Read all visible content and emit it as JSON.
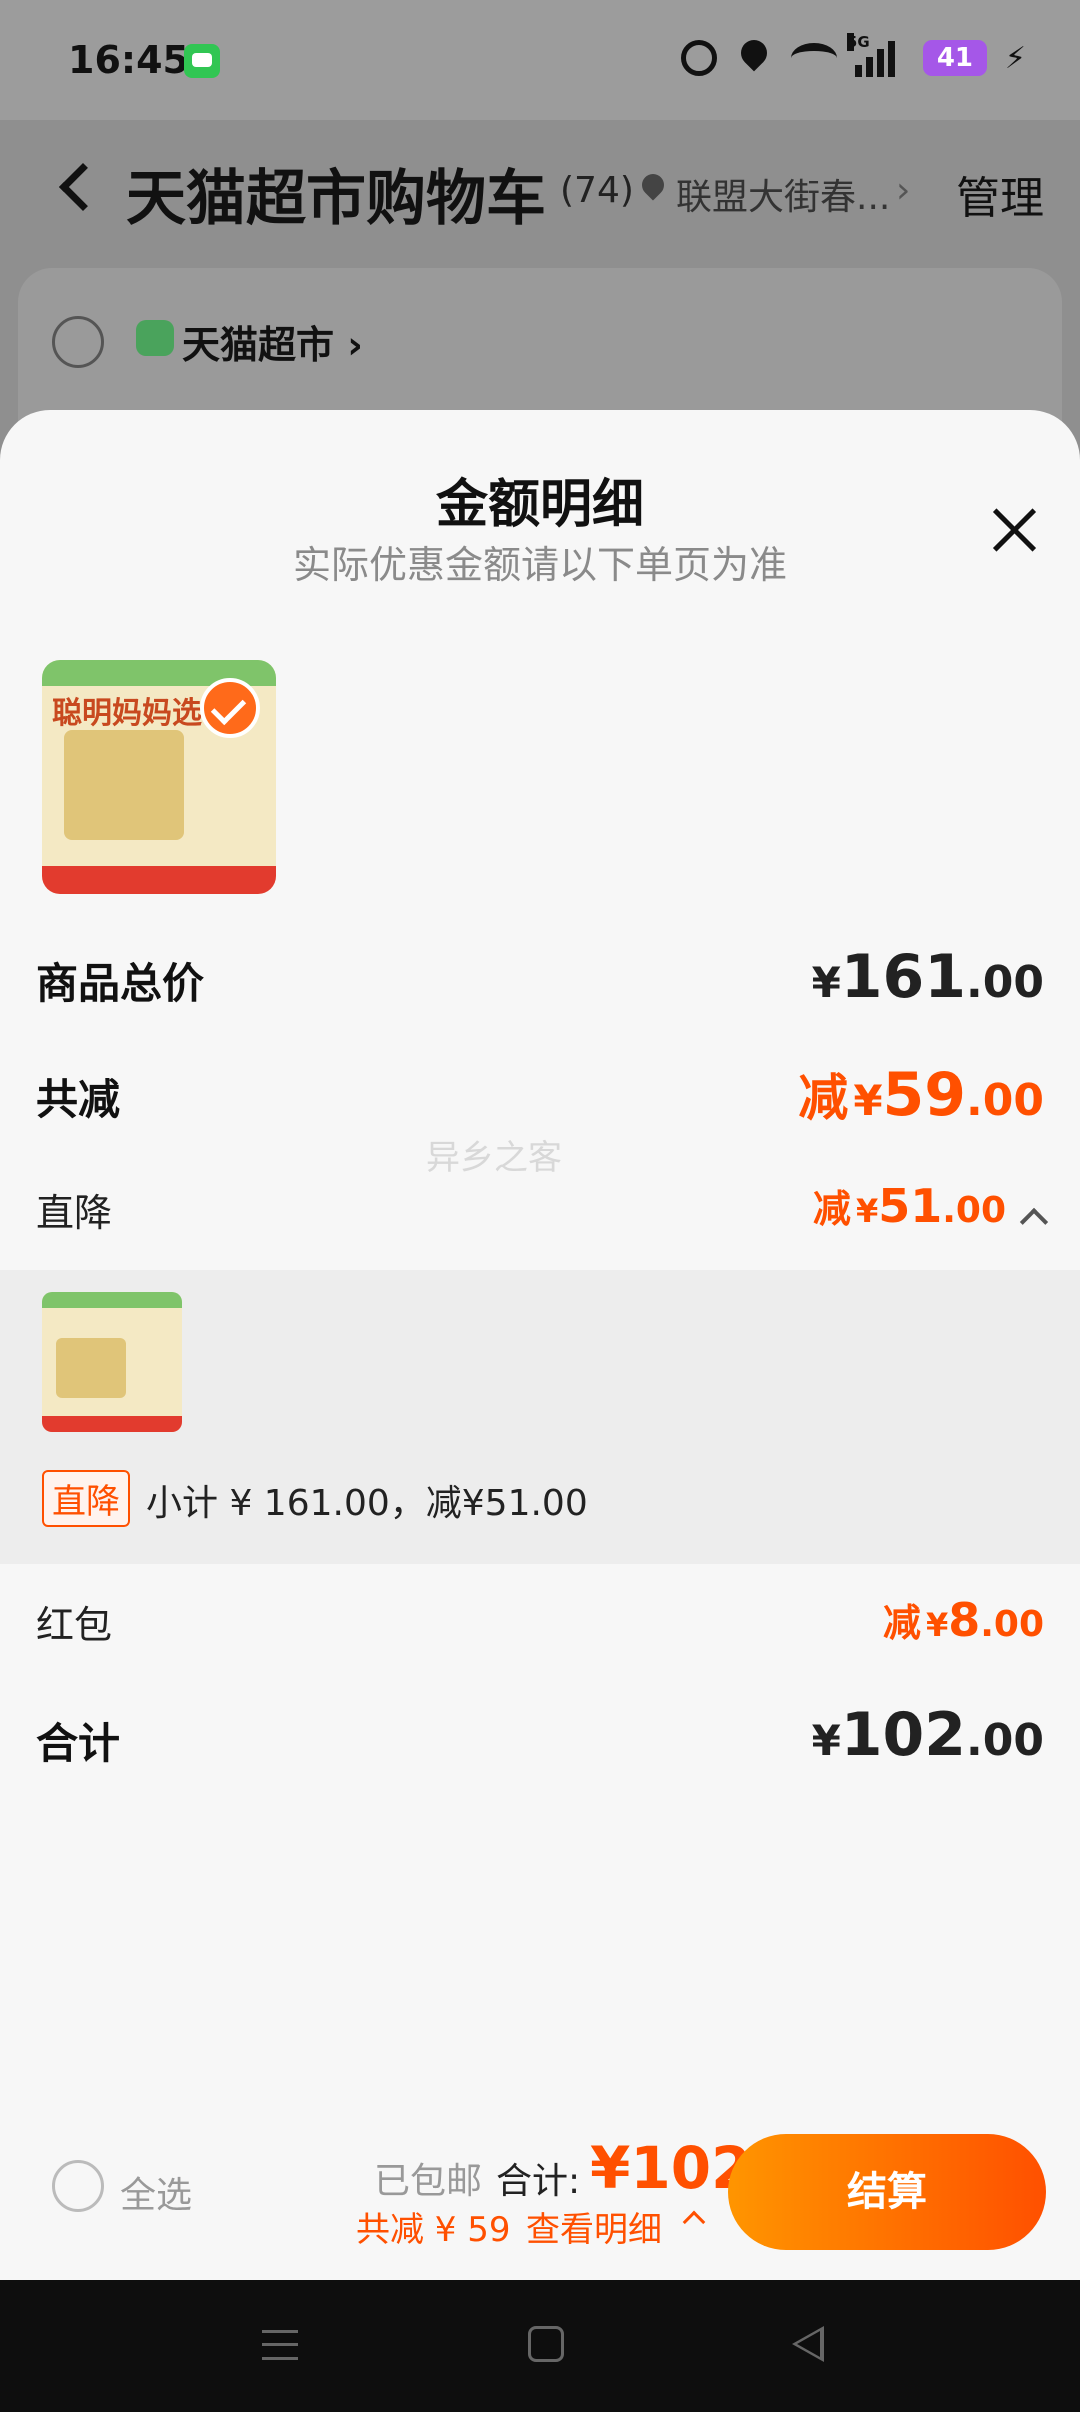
{
  "status_bar": {
    "time": "16:45",
    "network": "5G",
    "battery": "41",
    "icons": [
      "message-icon",
      "alarm-icon",
      "location-icon",
      "wifi-icon",
      "signal-icon",
      "battery-icon",
      "charging-icon"
    ]
  },
  "header": {
    "title": "天猫超市购物车",
    "count": "(74)",
    "location": "联盟大街春...",
    "manage_label": "管理"
  },
  "store": {
    "name": "天猫超市 ›"
  },
  "sheet": {
    "title": "金额明细",
    "subtitle": "实际优惠金额请以下单页为准",
    "product_image_text": "聪明妈妈选",
    "rows": {
      "total_price": {
        "label": "商品总价",
        "yen": "¥",
        "int": "161",
        "dec": ".00"
      },
      "total_discount": {
        "label": "共减",
        "prefix": "减",
        "yen": "¥",
        "int": "59",
        "dec": ".00"
      },
      "direct_discount": {
        "label": "直降",
        "prefix": "减",
        "yen": "¥",
        "int": "51",
        "dec": ".00"
      },
      "red_packet": {
        "label": "红包",
        "prefix": "减",
        "yen": "¥",
        "int": "8",
        "dec": ".00"
      },
      "grand_total": {
        "label": "合计",
        "yen": "¥",
        "int": "102",
        "dec": ".00"
      }
    },
    "detail": {
      "tag": "直降",
      "subtotal": "小计 ¥ 161.00，减¥51.00"
    },
    "watermark": "异乡之客"
  },
  "bottom_bar": {
    "select_all": "全选",
    "shipping": "已包邮",
    "total_label": "合计:",
    "total_amount": "¥102",
    "saving": "共减 ¥ 59",
    "detail_link": "查看明细",
    "checkout": "结算"
  },
  "colors": {
    "accent": "#ff5000",
    "checkout_gradient_start": "#ff9500",
    "checkout_gradient_end": "#ff5000"
  }
}
